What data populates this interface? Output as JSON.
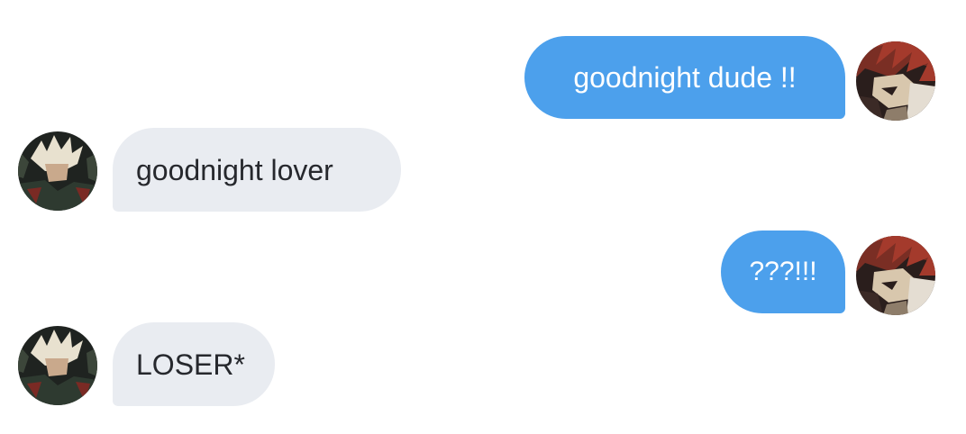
{
  "conversation": {
    "messages": [
      {
        "direction": "outgoing",
        "text": "goodnight dude !!",
        "avatar": "red-haired-character-avatar"
      },
      {
        "direction": "incoming",
        "text": "goodnight lover",
        "avatar": "blond-character-avatar"
      },
      {
        "direction": "outgoing",
        "text": "???!!!",
        "avatar": "red-haired-character-avatar"
      },
      {
        "direction": "incoming",
        "text": "LOSER*",
        "avatar": "blond-character-avatar"
      }
    ]
  },
  "colors": {
    "outgoing_bubble": "#4ca0ec",
    "incoming_bubble": "#e9ecf1",
    "outgoing_text": "#ffffff",
    "incoming_text": "#26282d",
    "background": "#ffffff"
  }
}
